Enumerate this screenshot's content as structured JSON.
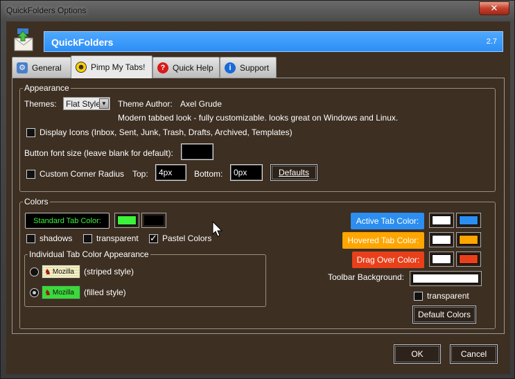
{
  "window": {
    "title": "QuickFolders Options",
    "close_symbol": "✕"
  },
  "banner": {
    "title": "QuickFolders",
    "version": "2.7"
  },
  "tabs": [
    {
      "label": "General",
      "icon": "gear-icon",
      "active": false
    },
    {
      "label": "Pimp My Tabs!",
      "icon": "smiley-icon",
      "active": true
    },
    {
      "label": "Quick Help",
      "icon": "help-icon",
      "active": false
    },
    {
      "label": "Support",
      "icon": "info-icon",
      "active": false
    }
  ],
  "appearance": {
    "legend": "Appearance",
    "themes_label": "Themes:",
    "theme_value": "Flat Style",
    "theme_author_label": "Theme Author:",
    "theme_author": "Axel Grude",
    "theme_description": "Modern tabbed look - fully customizable. looks great on Windows and Linux.",
    "display_icons_label": "Display Icons (Inbox, Sent, Junk, Trash, Drafts, Archived, Templates)",
    "display_icons_checked": false,
    "font_size_label": "Button font size (leave blank for default):",
    "font_size_value": "",
    "corner_radius_label": "Custom Corner Radius",
    "corner_radius_checked": false,
    "top_label": "Top:",
    "top_value": "4px",
    "bottom_label": "Bottom:",
    "bottom_value": "0px",
    "defaults_button": "Defaults"
  },
  "colors": {
    "legend": "Colors",
    "standard_tab_label": "Standard Tab Color:",
    "standard_tab_bg": "#3cf23c",
    "standard_tab_text": "#000000",
    "shadows_label": "shadows",
    "shadows_checked": false,
    "transparent_label": "transparent",
    "transparent_checked": false,
    "pastel_label": "Pastel Colors",
    "pastel_checked": true,
    "individual_legend": "Individual Tab Color Appearance",
    "striped_label": "(striped style)",
    "filled_label": "(filled style)",
    "preview_tab_text": "Mozilla",
    "striped_selected": false,
    "filled_selected": true,
    "active_tab_label": "Active Tab Color:",
    "active_tab_color": "#2b8ef0",
    "hovered_tab_label": "Hovered Tab Color:",
    "hovered_tab_color": "#ffa500",
    "drag_over_label": "Drag Over Color:",
    "drag_over_color": "#e8401a",
    "toolbar_bg_label": "Toolbar Background:",
    "toolbar_transparent_label": "transparent",
    "toolbar_transparent_checked": false,
    "default_colors_button": "Default Colors"
  },
  "footer": {
    "ok_label": "OK",
    "cancel_label": "Cancel"
  }
}
